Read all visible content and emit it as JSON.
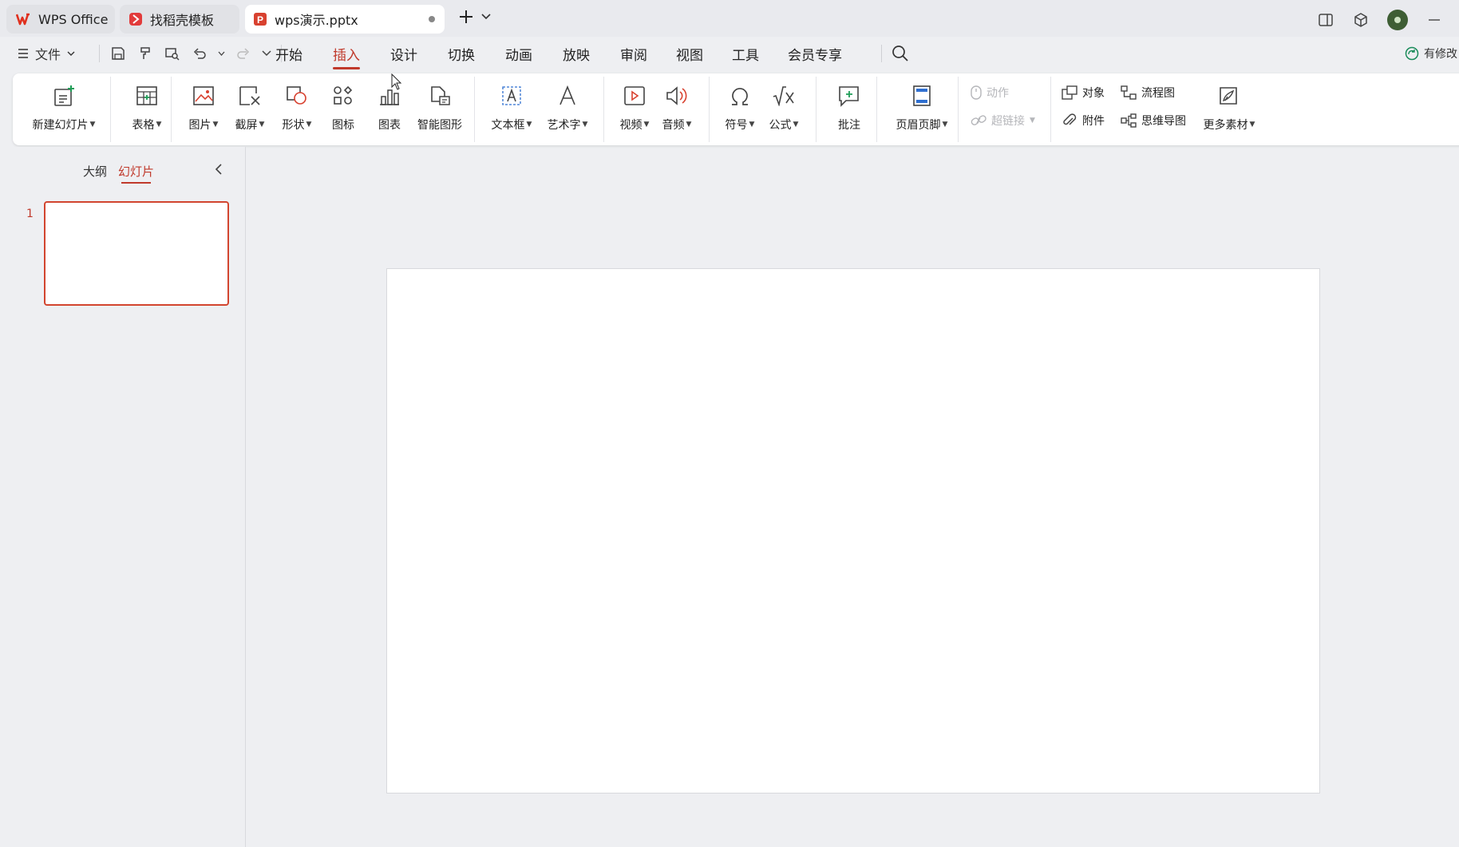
{
  "tabs": [
    {
      "label": "WPS Office",
      "icon": "wps-logo-icon"
    },
    {
      "label": "找稻壳模板",
      "icon": "daoke-icon"
    },
    {
      "label": "wps演示.pptx",
      "icon": "ppt-file-icon",
      "unsaved": true
    }
  ],
  "menu": {
    "file_label": "文件",
    "tabs": [
      "开始",
      "插入",
      "设计",
      "切换",
      "动画",
      "放映",
      "审阅",
      "视图",
      "工具",
      "会员专享"
    ],
    "active_tab": "插入",
    "save_status": "有修改"
  },
  "ribbon": {
    "new_slide": "新建幻灯片",
    "table": "表格",
    "picture": "图片",
    "screenshot": "截屏",
    "shape": "形状",
    "icon": "图标",
    "chart": "图表",
    "smartart": "智能图形",
    "textbox": "文本框",
    "wordart": "艺术字",
    "video": "视频",
    "audio": "音频",
    "symbol": "符号",
    "formula": "公式",
    "comment": "批注",
    "header_footer": "页眉页脚",
    "action": "动作",
    "hyperlink": "超链接",
    "object": "对象",
    "attachment": "附件",
    "flowchart": "流程图",
    "mindmap": "思维导图",
    "more_assets": "更多素材"
  },
  "left_panel": {
    "tab_outline": "大纲",
    "tab_slides": "幻灯片",
    "active": "幻灯片",
    "slides": [
      {
        "number": "1"
      }
    ]
  },
  "colors": {
    "accent": "#c0392b",
    "ribbon_bg": "#ffffff",
    "app_bg": "#eeeff2"
  }
}
